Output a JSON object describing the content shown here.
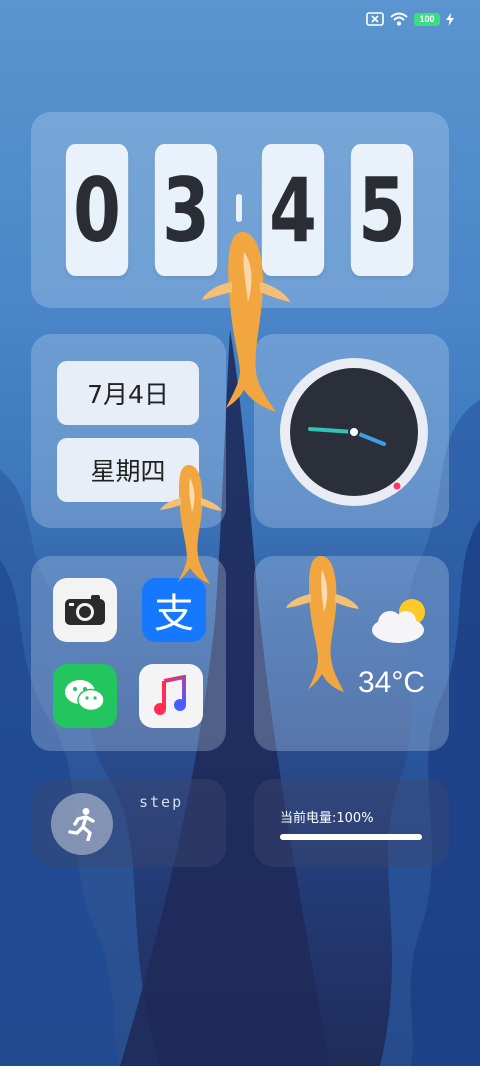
{
  "status_bar": {
    "battery_level": "100",
    "icons": [
      "no-sim-icon",
      "wifi-icon",
      "battery-icon",
      "charging-icon"
    ]
  },
  "clock": {
    "digits": [
      "0",
      "3",
      "4",
      "5"
    ]
  },
  "date": {
    "date_text": "7月4日",
    "weekday_text": "星期四"
  },
  "apps": [
    {
      "name": "camera-app-icon"
    },
    {
      "name": "alipay-app-icon",
      "glyph": "支"
    },
    {
      "name": "wechat-app-icon"
    },
    {
      "name": "music-app-icon"
    }
  ],
  "weather": {
    "temperature": "34°C",
    "icon": "partly-cloudy-icon"
  },
  "steps": {
    "label": "step",
    "icon": "running-person-icon"
  },
  "battery_widget": {
    "label": "当前电量:100%",
    "level_fraction": 1.0
  },
  "colors": {
    "accent_teal": "#2ec4b6",
    "accent_blue": "#3aa0e8",
    "battery_text": "#3ddc84"
  }
}
